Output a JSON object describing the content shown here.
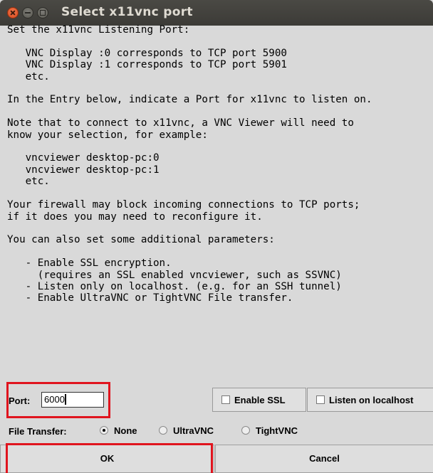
{
  "window": {
    "title": "Select x11vnc port"
  },
  "message": {
    "lines": [
      "Set the x11vnc Listening Port:",
      "",
      "   VNC Display :0 corresponds to TCP port 5900",
      "   VNC Display :1 corresponds to TCP port 5901",
      "   etc.",
      "",
      "In the Entry below, indicate a Port for x11vnc to listen on.",
      "",
      "Note that to connect to x11vnc, a VNC Viewer will need to",
      "know your selection, for example:",
      "",
      "   vncviewer desktop-pc:0",
      "   vncviewer desktop-pc:1",
      "   etc.",
      "",
      "Your firewall may block incoming connections to TCP ports;",
      "if it does you may need to reconfigure it.",
      "",
      "You can also set some additional parameters:",
      "",
      "   - Enable SSL encryption.",
      "     (requires an SSL enabled vncviewer, such as SSVNC)",
      "   - Listen only on localhost. (e.g. for an SSH tunnel)",
      "   - Enable UltraVNC or TightVNC File transfer."
    ]
  },
  "port": {
    "label": "Port:",
    "value": "6000"
  },
  "options": {
    "enable_ssl": "Enable SSL",
    "listen_localhost": "Listen on localhost"
  },
  "file_transfer": {
    "label": "File Transfer:",
    "options": [
      "None",
      "UltraVNC",
      "TightVNC"
    ],
    "selected": "None"
  },
  "buttons": {
    "ok": "OK",
    "cancel": "Cancel"
  },
  "colors": {
    "highlight": "#e0141e",
    "titlebar": "#3c3b37",
    "close_button": "#e95420"
  },
  "icons": [
    "close-icon",
    "minimize-icon",
    "maximize-icon"
  ]
}
